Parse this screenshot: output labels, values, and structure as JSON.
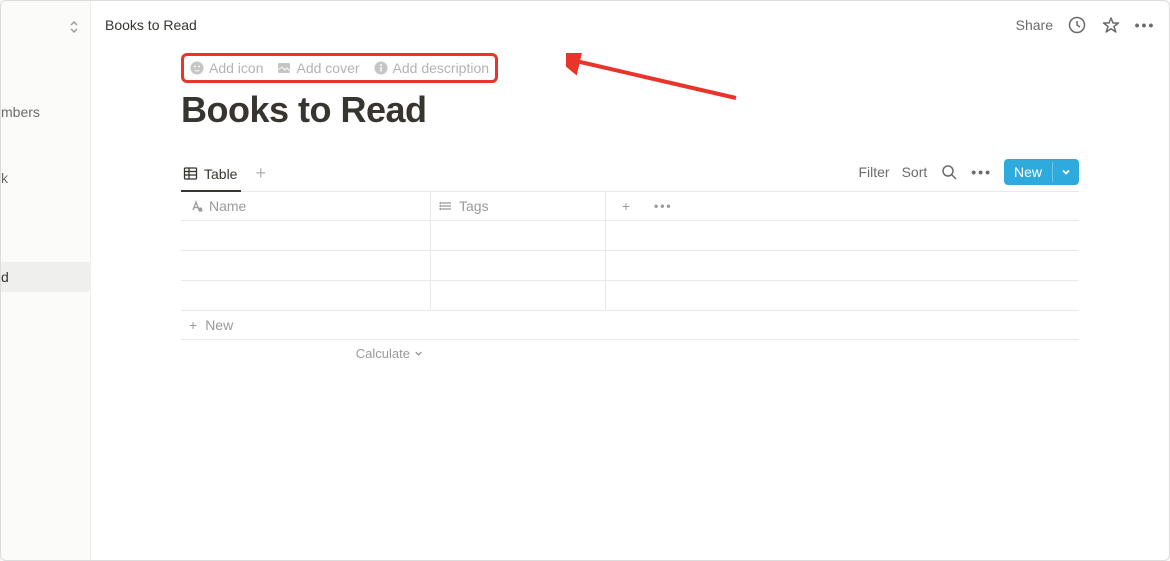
{
  "breadcrumb": "Books to Read",
  "topbar": {
    "share": "Share"
  },
  "sidebar": {
    "fragments": [
      "mbers",
      "",
      "k",
      "d"
    ],
    "selected_index": 3
  },
  "hover": {
    "add_icon": "Add icon",
    "add_cover": "Add cover",
    "add_description": "Add description"
  },
  "title": "Books to Read",
  "views": {
    "active": "Table",
    "actions": {
      "filter": "Filter",
      "sort": "Sort"
    },
    "new_button": "New"
  },
  "table": {
    "columns": {
      "name": "Name",
      "tags": "Tags"
    },
    "empty_rows": 3,
    "new_row": "New",
    "calculate": "Calculate"
  },
  "annotation": {
    "color": "#e8342b"
  }
}
